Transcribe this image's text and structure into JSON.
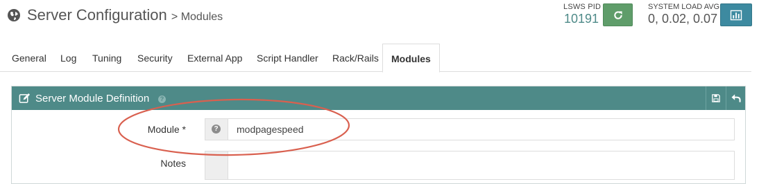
{
  "header": {
    "title": "Server Configuration",
    "subtitle": "> Modules",
    "pid_label": "LSWS PID",
    "pid_value": "10191",
    "load_label": "SYSTEM LOAD AVG",
    "load_value": "0, 0.02, 0.07",
    "restart_icon": "refresh-icon",
    "graph_icon": "bar-chart-icon"
  },
  "tabs": [
    {
      "label": "General"
    },
    {
      "label": "Log"
    },
    {
      "label": "Tuning"
    },
    {
      "label": "Security"
    },
    {
      "label": "External App"
    },
    {
      "label": "Script Handler"
    },
    {
      "label": "Rack/Rails"
    },
    {
      "label": "Modules",
      "active": true
    }
  ],
  "panel": {
    "title": "Server Module Definition",
    "help": "?",
    "save_icon": "save-icon",
    "back_icon": "back-arrow-icon"
  },
  "form": {
    "module_label": "Module *",
    "module_value": "modpagespeed",
    "module_help": "?",
    "notes_label": "Notes",
    "notes_value": ""
  },
  "colors": {
    "accent": "#4e8a88",
    "restart_button": "#5f9d6a",
    "graph_button": "#3d8aa0",
    "annotation": "#d9604f"
  }
}
